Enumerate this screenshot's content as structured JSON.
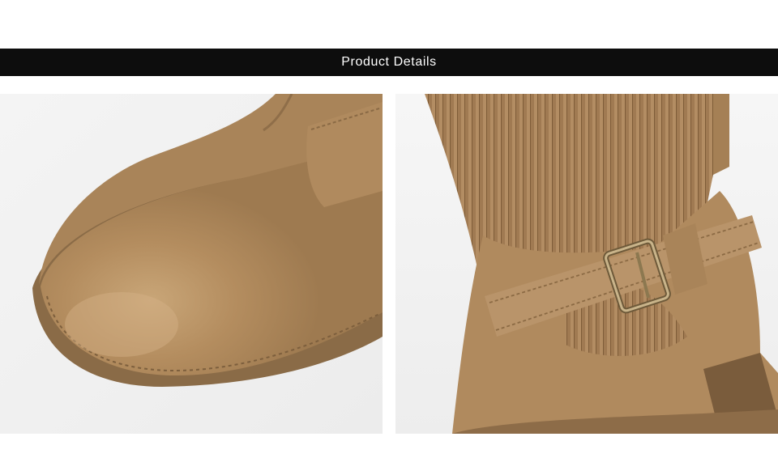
{
  "header": {
    "title": "Product Details",
    "background": "#0d0d0d",
    "text_color": "#ffffff"
  },
  "photos": [
    {
      "subject": "boot-toe-closeup",
      "tone": "#b08a5e"
    },
    {
      "subject": "boot-buckle-knit-shaft-closeup",
      "tone": "#a98559"
    }
  ]
}
